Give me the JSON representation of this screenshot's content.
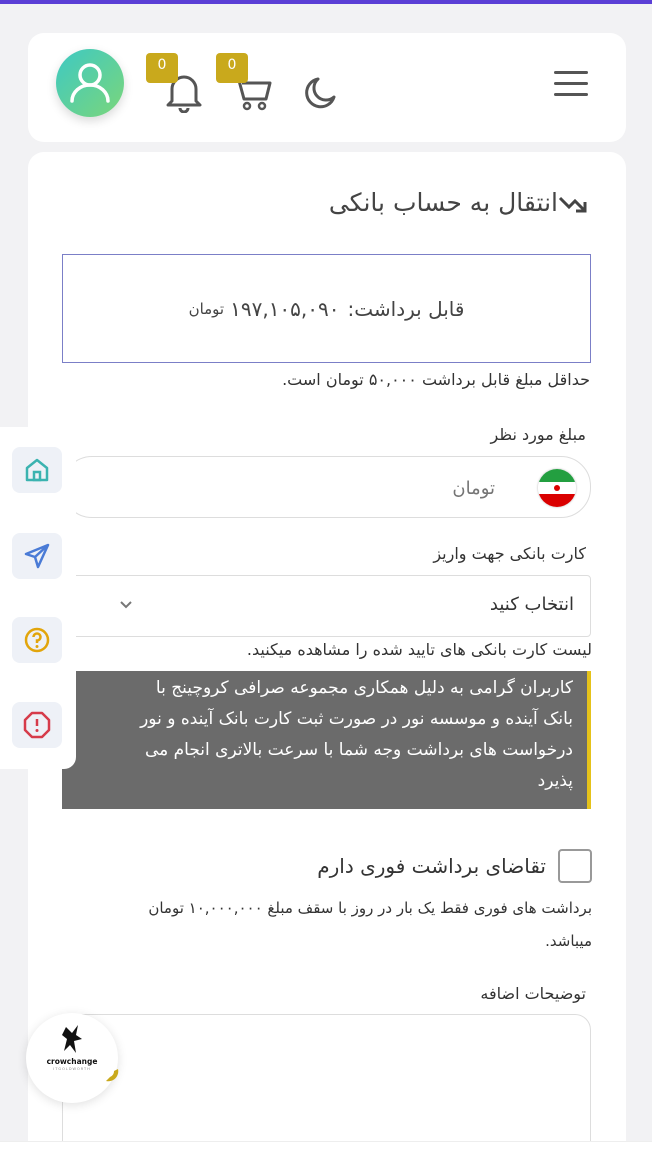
{
  "header": {
    "cart_badge": "0",
    "notif_badge": "0"
  },
  "page": {
    "title": "انتقال به حساب بانکی"
  },
  "balance": {
    "label": "قابل برداشت:",
    "amount": "۱۹۷,۱۰۵,۰۹۰",
    "unit": "تومان"
  },
  "minimum_note": "حداقل مبلغ قابل برداشت ۵۰,۰۰۰ تومان است.",
  "amount_field": {
    "label": "مبلغ مورد نظر",
    "placeholder": "تومان"
  },
  "bank_card": {
    "label": "کارت بانکی جهت واریز",
    "selected": "انتخاب کنید",
    "hint": "لیست کارت بانکی های تایید شده را مشاهده میکنید."
  },
  "notice": {
    "lines": [
      "کاربران گرامی به دلیل همکاری مجموعه صرافی کروچینج با",
      "بانک آینده و موسسه نور در صورت ثبت کارت بانک آینده و نور",
      "درخواست های برداشت وجه شما با سرعت بالاتری انجام می",
      "پذیرد"
    ]
  },
  "instant": {
    "label": "تقاضای برداشت فوری دارم",
    "note": "برداشت های فوری فقط یک بار در روز با سقف مبلغ ۱۰,۰۰۰,۰۰۰ تومان میباشد."
  },
  "extra": {
    "label": "توضیحات اضافه"
  },
  "logo": {
    "brand": "crowchange",
    "sub": "ITGOLDWORTH"
  },
  "colors": {
    "accent": "#5b3fd6",
    "badge": "#c9a91c",
    "notice_bg": "#6b6b6b",
    "notice_border": "#e5c21a"
  }
}
